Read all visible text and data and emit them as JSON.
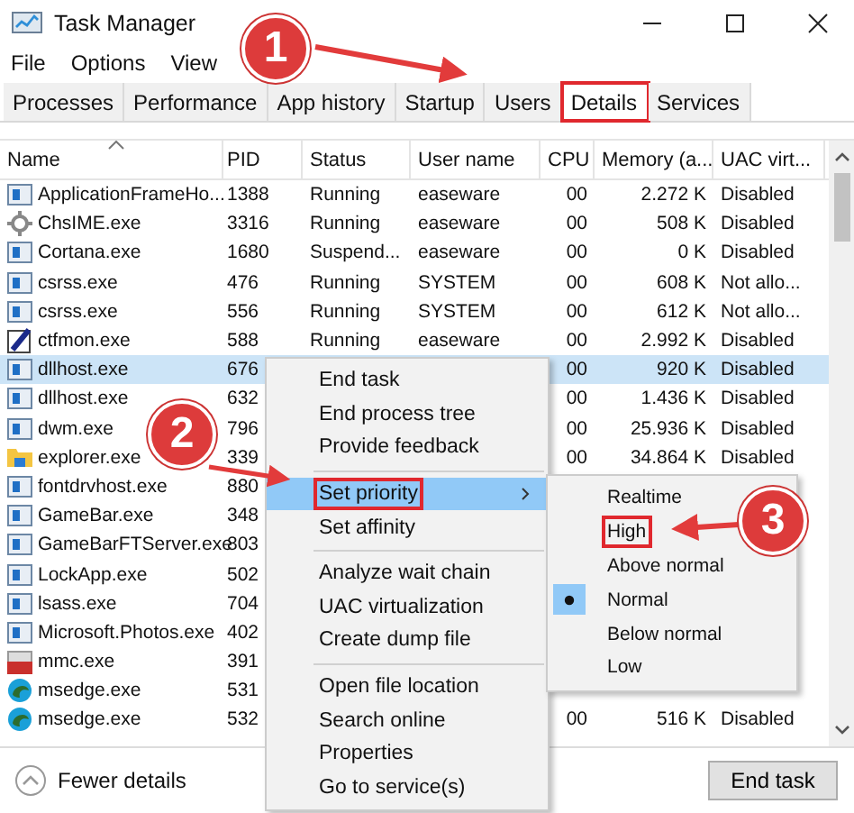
{
  "window": {
    "title": "Task Manager"
  },
  "menu_bar": [
    "File",
    "Options",
    "View"
  ],
  "tabs": [
    {
      "label": "Processes",
      "selected": false,
      "annotated": false
    },
    {
      "label": "Performance",
      "selected": false,
      "annotated": false
    },
    {
      "label": "App history",
      "selected": false,
      "annotated": false
    },
    {
      "label": "Startup",
      "selected": false,
      "annotated": false
    },
    {
      "label": "Users",
      "selected": false,
      "annotated": false
    },
    {
      "label": "Details",
      "selected": true,
      "annotated": true
    },
    {
      "label": "Services",
      "selected": false,
      "annotated": false
    }
  ],
  "table": {
    "columns": [
      "Name",
      "PID",
      "Status",
      "User name",
      "CPU",
      "Memory (a...",
      "UAC virt..."
    ],
    "rows": [
      {
        "kind": "app",
        "selected": false,
        "cells": [
          "ApplicationFrameHo...",
          "1388",
          "Running",
          "easeware",
          "00",
          "2.272 K",
          "Disabled"
        ]
      },
      {
        "kind": "ime",
        "selected": false,
        "cells": [
          "ChsIME.exe",
          "3316",
          "Running",
          "easeware",
          "00",
          "508 K",
          "Disabled"
        ]
      },
      {
        "kind": "app",
        "selected": false,
        "cells": [
          "Cortana.exe",
          "1680",
          "Suspend...",
          "easeware",
          "00",
          "0 K",
          "Disabled"
        ]
      },
      {
        "kind": "app",
        "selected": false,
        "cells": [
          "csrss.exe",
          "476",
          "Running",
          "SYSTEM",
          "00",
          "608 K",
          "Not allo..."
        ]
      },
      {
        "kind": "app",
        "selected": false,
        "cells": [
          "csrss.exe",
          "556",
          "Running",
          "SYSTEM",
          "00",
          "612 K",
          "Not allo..."
        ]
      },
      {
        "kind": "pen",
        "selected": false,
        "cells": [
          "ctfmon.exe",
          "588",
          "Running",
          "easeware",
          "00",
          "2.992 K",
          "Disabled"
        ]
      },
      {
        "kind": "app",
        "selected": true,
        "cells": [
          "dllhost.exe",
          "676",
          "",
          "",
          "00",
          "920 K",
          "Disabled"
        ]
      },
      {
        "kind": "app",
        "selected": false,
        "cells": [
          "dllhost.exe",
          "632",
          "",
          "",
          "00",
          "1.436 K",
          "Disabled"
        ]
      },
      {
        "kind": "app",
        "selected": false,
        "cells": [
          "dwm.exe",
          "796",
          "",
          "",
          "00",
          "25.936 K",
          "Disabled"
        ]
      },
      {
        "kind": "folder",
        "selected": false,
        "cells": [
          "explorer.exe",
          "339",
          "",
          "",
          "00",
          "34.864 K",
          "Disabled"
        ]
      },
      {
        "kind": "app",
        "selected": false,
        "cells": [
          "fontdrvhost.exe",
          "880"
        ]
      },
      {
        "kind": "app",
        "selected": false,
        "cells": [
          "GameBar.exe",
          "348"
        ]
      },
      {
        "kind": "app",
        "selected": false,
        "cells": [
          "GameBarFTServer.exe",
          "803"
        ]
      },
      {
        "kind": "app",
        "selected": false,
        "cells": [
          "LockApp.exe",
          "502"
        ]
      },
      {
        "kind": "app",
        "selected": false,
        "cells": [
          "lsass.exe",
          "704"
        ]
      },
      {
        "kind": "app",
        "selected": false,
        "cells": [
          "Microsoft.Photos.exe",
          "402"
        ]
      },
      {
        "kind": "console",
        "selected": false,
        "cells": [
          "mmc.exe",
          "391"
        ]
      },
      {
        "kind": "edge",
        "selected": false,
        "cells": [
          "msedge.exe",
          "531"
        ]
      },
      {
        "kind": "edge",
        "selected": false,
        "cells": [
          "msedge.exe",
          "532",
          "",
          "",
          "00",
          "516 K",
          "Disabled"
        ]
      }
    ]
  },
  "context_menu": {
    "groups": [
      [
        {
          "label": "End task",
          "highlighted": false,
          "annotated": false,
          "submenu": false
        },
        {
          "label": "End process tree",
          "highlighted": false,
          "annotated": false,
          "submenu": false
        },
        {
          "label": "Provide feedback",
          "highlighted": false,
          "annotated": false,
          "submenu": false
        }
      ],
      [
        {
          "label": "Set priority",
          "highlighted": true,
          "annotated": true,
          "submenu": true
        },
        {
          "label": "Set affinity",
          "highlighted": false,
          "annotated": false,
          "submenu": false
        }
      ],
      [
        {
          "label": "Analyze wait chain",
          "highlighted": false,
          "annotated": false,
          "submenu": false
        },
        {
          "label": "UAC virtualization",
          "highlighted": false,
          "annotated": false,
          "submenu": false
        },
        {
          "label": "Create dump file",
          "highlighted": false,
          "annotated": false,
          "submenu": false
        }
      ],
      [
        {
          "label": "Open file location",
          "highlighted": false,
          "annotated": false,
          "submenu": false
        },
        {
          "label": "Search online",
          "highlighted": false,
          "annotated": false,
          "submenu": false
        },
        {
          "label": "Properties",
          "highlighted": false,
          "annotated": false,
          "submenu": false
        },
        {
          "label": "Go to service(s)",
          "highlighted": false,
          "annotated": false,
          "submenu": false
        }
      ]
    ]
  },
  "priority_menu": [
    {
      "label": "Realtime",
      "selected": false,
      "annotated": false
    },
    {
      "label": "High",
      "selected": false,
      "annotated": true
    },
    {
      "label": "Above normal",
      "selected": false,
      "annotated": false
    },
    {
      "label": "Normal",
      "selected": true,
      "annotated": false
    },
    {
      "label": "Below normal",
      "selected": false,
      "annotated": false
    },
    {
      "label": "Low",
      "selected": false,
      "annotated": false
    }
  ],
  "footer": {
    "toggle": "Fewer details",
    "button": "End task"
  },
  "annotations": [
    {
      "label": "1"
    },
    {
      "label": "2"
    },
    {
      "label": "3"
    }
  ]
}
